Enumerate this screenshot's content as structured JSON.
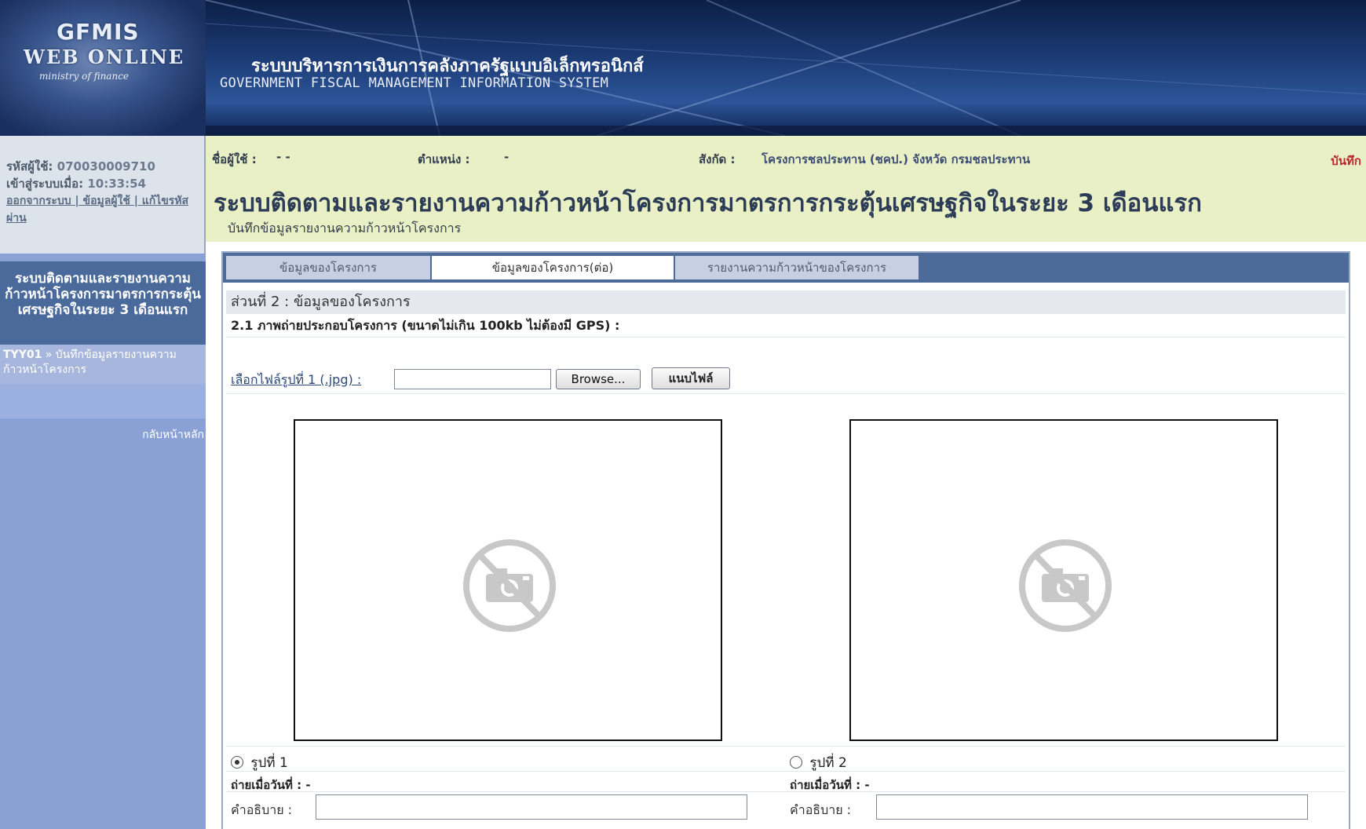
{
  "header": {
    "logo_line1": "GFMIS",
    "logo_line2": "WEB ONLINE",
    "logo_line3": "ministry of finance",
    "system_name_th": "ระบบบริหารการเงินการคลังภาครัฐแบบอิเล็กทรอนิกส์",
    "system_name_en": "GOVERNMENT FISCAL MANAGEMENT INFORMATION SYSTEM"
  },
  "sidebar": {
    "user_id_label": "รหัสผู้ใช้:",
    "user_id": "070030009710",
    "login_label": "เข้าสู่ระบบเมื่อ:",
    "login_time": "10:33:54",
    "links": "ออกจากระบบ | ข้อมูลผู้ใช้ | แก้ไขรหัสผ่าน",
    "menu_title": "ระบบติดตามและรายงานความก้าวหน้าโครงการมาตรการกระตุ้นเศรษฐกิจในระยะ 3 เดือนแรก",
    "menu_code": "TYY01",
    "menu_item": "» บันทึกข้อมูลรายงานความก้าวหน้าโครงการ",
    "back_home": "กลับหน้าหลัก"
  },
  "info": {
    "username_label": "ชื่อผู้ใช้ :",
    "username": "- -",
    "position_label": "ตำแหน่ง :",
    "position": "-",
    "dept_label": "สังกัด :",
    "dept": "โครงการชลประทาน (ชคป.) จังหวัด กรมชลประทาน",
    "save_link": "บันทึก",
    "main_title": "ระบบติดตามและรายงานความก้าวหน้าโครงการมาตรการกระตุ้นเศรษฐกิจในระยะ 3 เดือนแรก",
    "sub_title": "บันทึกข้อมูลรายงานความก้าวหน้าโครงการ"
  },
  "tabs": [
    {
      "label": "ข้อมูลของโครงการ"
    },
    {
      "label": "ข้อมูลของโครงการ(ต่อ)"
    },
    {
      "label": "รายงานความก้าวหน้าของโครงการ"
    }
  ],
  "section": {
    "heading": "ส่วนที่ 2 : ข้อมูลของโครงการ",
    "subheading": "2.1 ภาพถ่ายประกอบโครงการ (ขนาดไม่เกิน 100kb ไม่ต้องมี GPS) :",
    "upload_label": "เลือกไฟล์รูปที่ 1 (.jpg) :",
    "file_value": "",
    "browse_label": "Browse...",
    "attach_label": "แนบไฟล์"
  },
  "photos": [
    {
      "radio_label": "รูปที่ 1",
      "selected": true,
      "date_label": "ถ่ายเมื่อวันที่ : -",
      "desc_label": "คำอธิบาย :",
      "desc_value": ""
    },
    {
      "radio_label": "รูปที่ 2",
      "selected": false,
      "date_label": "ถ่ายเมื่อวันที่ : -",
      "desc_label": "คำอธิบาย :",
      "desc_value": ""
    }
  ],
  "colors": {
    "banner": "#1d3d78",
    "sidebar": "#8aa1d6",
    "infobar": "#eaf0c6",
    "tabbar": "#4d6b99",
    "save_link": "#c0262d"
  }
}
